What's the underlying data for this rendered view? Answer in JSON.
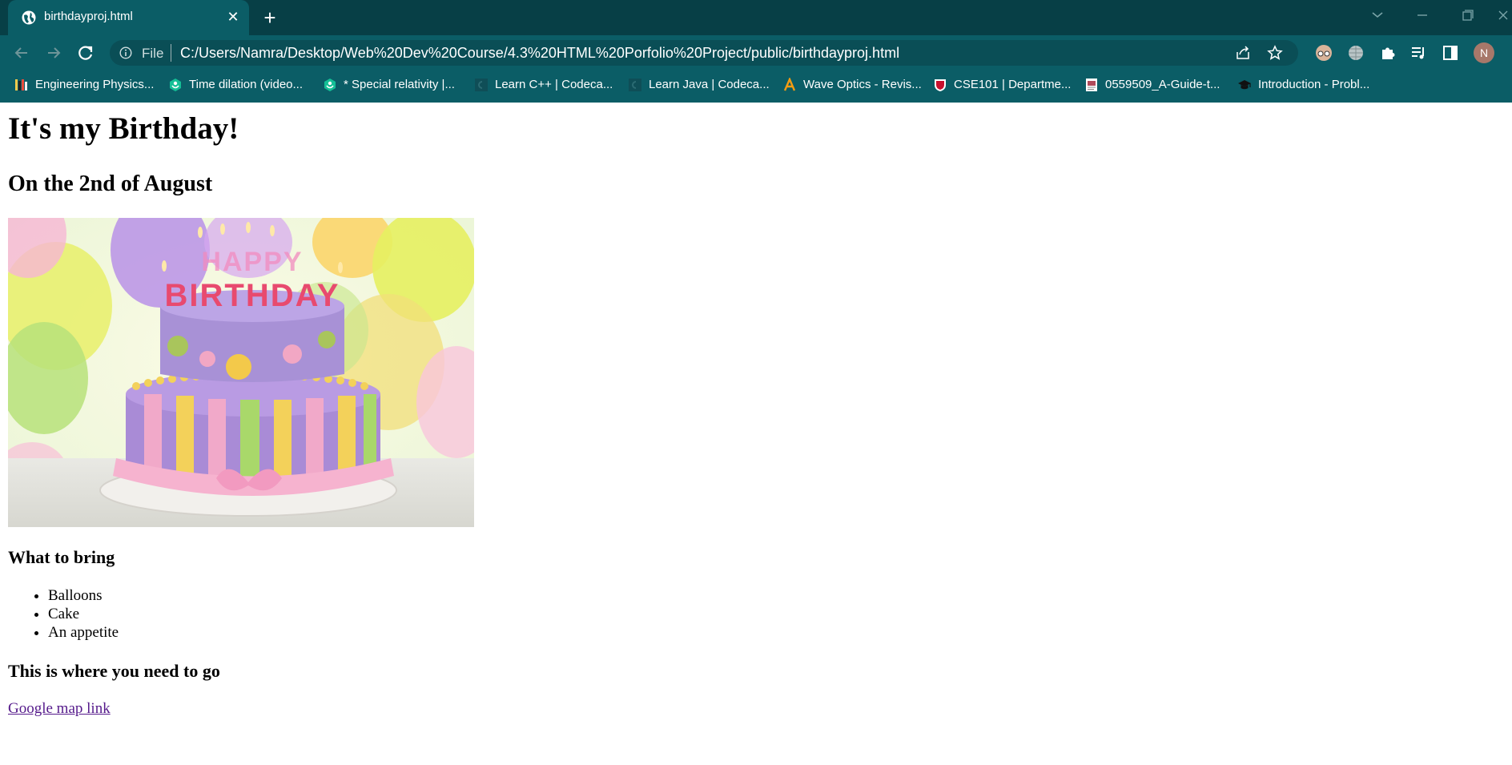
{
  "browser": {
    "tab": {
      "title": "birthdayproj.html",
      "favicon": "globe-icon"
    },
    "address_bar": {
      "scheme_label": "File",
      "url": "C:/Users/Namra/Desktop/Web%20Dev%20Course/4.3%20HTML%20Porfolio%20Project/public/birthdayproj.html"
    },
    "profile_initial": "N",
    "colors": {
      "frame": "#073f46",
      "toolbar": "#0b5d66",
      "omnibox": "#0a4e56"
    }
  },
  "bookmarks": [
    {
      "label": "Engineering Physics...",
      "icon": "books-icon"
    },
    {
      "label": "Time dilation (video...",
      "icon": "khan-academy-icon"
    },
    {
      "label": "* Special relativity |...",
      "icon": "khan-academy-icon"
    },
    {
      "label": "Learn C++ | Codeca...",
      "icon": "codecademy-icon"
    },
    {
      "label": "Learn Java | Codeca...",
      "icon": "codecademy-icon"
    },
    {
      "label": "Wave Optics - Revis...",
      "icon": "letter-a-icon"
    },
    {
      "label": "CSE101 | Departme...",
      "icon": "shield-icon"
    },
    {
      "label": "0559509_A-Guide-t...",
      "icon": "document-icon"
    },
    {
      "label": "Introduction - Probl...",
      "icon": "graduation-cap-icon"
    }
  ],
  "page": {
    "heading": "It's my Birthday!",
    "subheading": "On the 2nd of August",
    "image_caption_text": "HAPPY BIRTHDAY",
    "bring_heading": "What to bring",
    "bring_items": [
      "Balloons",
      "Cake",
      "An appetite"
    ],
    "where_heading": "This is where you need to go",
    "map_link_text": "Google map link",
    "colors": {
      "link_visited": "#551a8b"
    }
  }
}
